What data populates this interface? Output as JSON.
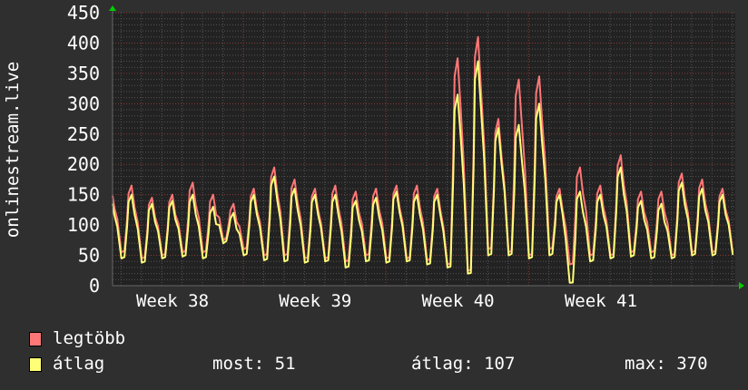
{
  "chart_data": {
    "type": "line",
    "ylabel": "onlinestream.live",
    "ylim": [
      0,
      450
    ],
    "yticks": [
      "0",
      "50",
      "100",
      "150",
      "200",
      "250",
      "300",
      "350",
      "400",
      "450"
    ],
    "xticks": [
      "Week 38",
      "Week 39",
      "Week 40",
      "Week 41"
    ],
    "series": [
      {
        "name": "legtöbb",
        "color": "#ff7777",
        "peaks": [
          165,
          165,
          145,
          150,
          170,
          150,
          135,
          160,
          195,
          175,
          160,
          165,
          155,
          160,
          165,
          165,
          160,
          375,
          410,
          275,
          340,
          345,
          160,
          195,
          165,
          215,
          155,
          155,
          185,
          175,
          160
        ],
        "troughs": [
          55,
          45,
          50,
          55,
          55,
          75,
          60,
          50,
          50,
          45,
          45,
          40,
          50,
          45,
          45,
          42,
          35,
          25,
          60,
          55,
          50,
          60,
          35,
          50,
          50,
          55,
          55,
          50,
          55,
          55,
          55
        ]
      },
      {
        "name": "átlag",
        "color": "#ffff77",
        "peaks": [
          150,
          150,
          135,
          140,
          150,
          130,
          120,
          150,
          180,
          160,
          150,
          150,
          140,
          145,
          155,
          150,
          150,
          315,
          370,
          260,
          265,
          300,
          150,
          155,
          150,
          195,
          140,
          135,
          170,
          160,
          150
        ],
        "troughs": [
          45,
          38,
          45,
          48,
          45,
          70,
          50,
          42,
          40,
          38,
          40,
          30,
          40,
          38,
          40,
          35,
          30,
          20,
          50,
          50,
          45,
          50,
          5,
          40,
          45,
          48,
          45,
          45,
          50,
          50,
          51
        ]
      }
    ]
  },
  "legend": {
    "items": [
      {
        "label": "legtöbb",
        "color": "#ff7777"
      },
      {
        "label": "átlag",
        "color": "#ffff77"
      }
    ],
    "stats": {
      "now": "most: 51",
      "avg": "átlag: 107",
      "max": "max: 370"
    }
  }
}
